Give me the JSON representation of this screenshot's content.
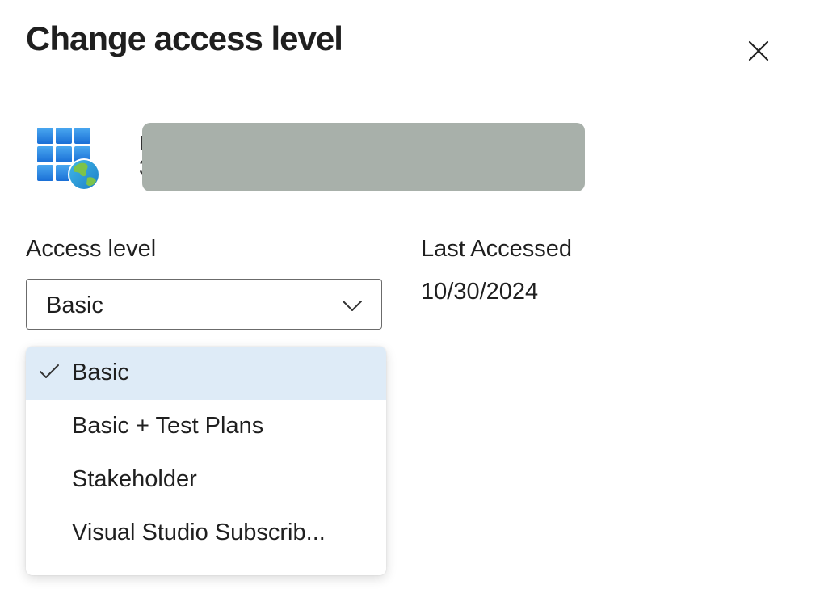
{
  "dialog": {
    "title": "Change access level",
    "close_icon": "close-icon"
  },
  "user": {
    "icon": "grid-globe-icon",
    "name_initial": "I",
    "detail_initial": "3",
    "redaction_color": "#a8b0aa"
  },
  "access_level": {
    "label": "Access level",
    "selected": "Basic",
    "chevron_icon": "chevron-down-icon"
  },
  "last_accessed": {
    "label": "Last Accessed",
    "value": "10/30/2024"
  },
  "dropdown": {
    "options": [
      {
        "label": "Basic",
        "selected": true
      },
      {
        "label": "Basic + Test Plans",
        "selected": false
      },
      {
        "label": "Stakeholder",
        "selected": false
      },
      {
        "label": "Visual Studio Subscrib...",
        "selected": false
      }
    ],
    "check_icon": "checkmark-icon",
    "selected_bg": "#deebf7"
  }
}
